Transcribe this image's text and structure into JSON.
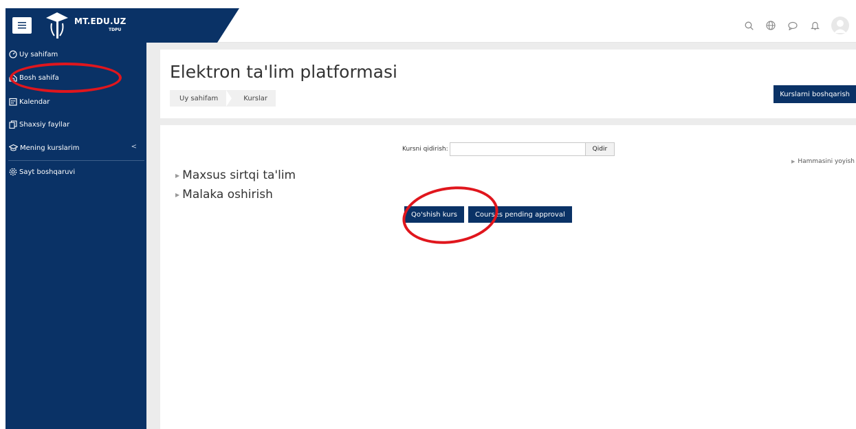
{
  "navbar": {
    "brand_name": "MT.EDU.UZ",
    "brand_sub": "TDPU",
    "menu_icon": "hamburger-icon",
    "icons": [
      "search-icon",
      "globe-icon",
      "chat-icon",
      "bell-icon",
      "avatar"
    ]
  },
  "sidebar": {
    "items": [
      {
        "label": "Uy sahifam",
        "icon": "dashboard-icon"
      },
      {
        "label": "Bosh sahifa",
        "icon": "home-icon"
      },
      {
        "label": "Kalendar",
        "icon": "calendar-icon"
      },
      {
        "label": "Shaxsiy fayllar",
        "icon": "files-icon"
      },
      {
        "label": "Mening kurslarim",
        "icon": "graduation-cap-icon",
        "chevron": "<"
      },
      {
        "label": "Sayt boshqaruvi",
        "icon": "gear-icon"
      }
    ]
  },
  "header": {
    "title": "Elektron ta'lim platformasi",
    "breadcrumb": [
      "Uy sahifam",
      "Kurslar"
    ],
    "manage_button": "Kurslarni boshqarish"
  },
  "content": {
    "search_label": "Kursni qidirish:",
    "search_value": "",
    "search_button": "Qidir",
    "expand_all": "Hammasini yoyish",
    "categories": [
      "Maxsus sirtqi ta'lim",
      "Malaka oshirish"
    ],
    "add_course_button": "Qo'shish kurs",
    "pending_button": "Courses pending approval"
  },
  "colors": {
    "navy": "#0a3266",
    "highlight_red": "#e0161d"
  }
}
